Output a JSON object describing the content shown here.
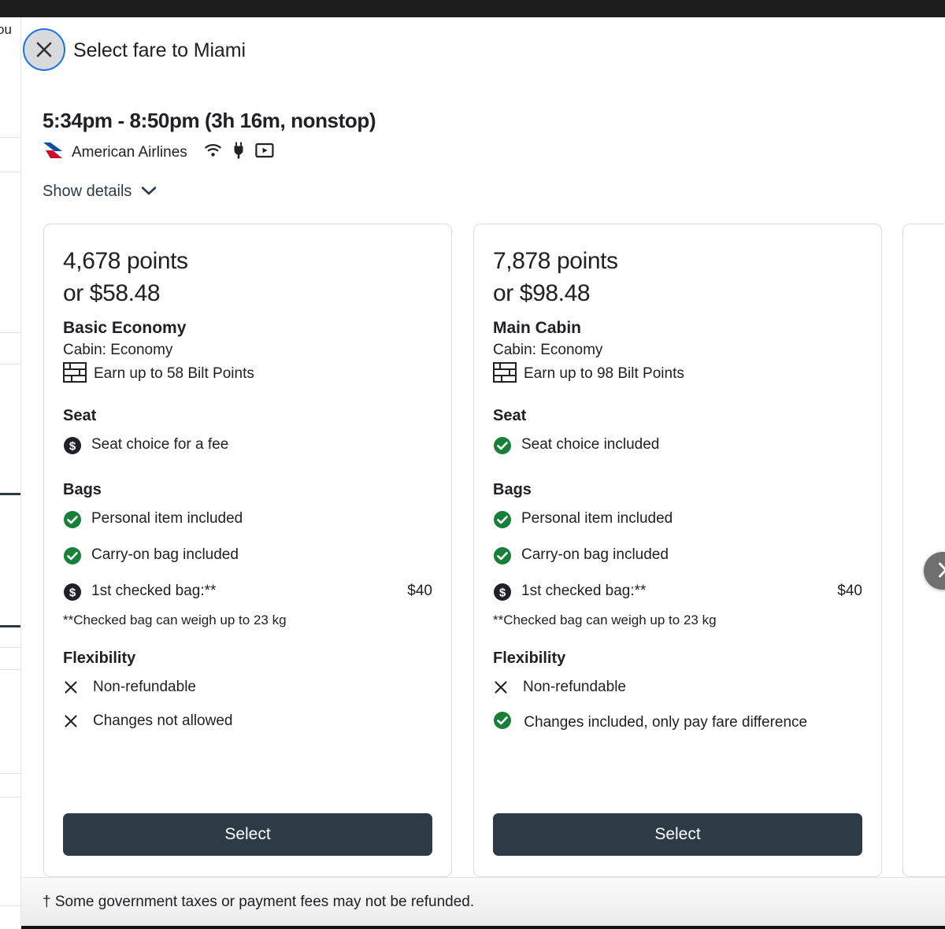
{
  "header": {
    "close_icon": "close-icon",
    "title": "Select fare to Miami"
  },
  "background_page": {
    "text_fragment": "ou"
  },
  "flight": {
    "times": "5:34pm - 8:50pm (3h 16m, nonstop)",
    "airline": "American Airlines",
    "airline_logo": "american-airlines-logo",
    "amenities": [
      "wifi-icon",
      "power-outlet-icon",
      "in-flight-entertainment-icon"
    ],
    "show_details_label": "Show details",
    "show_details_chevron": "chevron-down-icon"
  },
  "fares": [
    {
      "points": "4,678 points",
      "cash": "or $58.48",
      "name": "Basic Economy",
      "cabin": "Cabin: Economy",
      "earn_icon": "bilt-brick-icon",
      "earn": "Earn up to 58 Bilt Points",
      "seat_title": "Seat",
      "seat": [
        {
          "icon": "fee-dollar-icon",
          "label": "Seat choice for a fee"
        }
      ],
      "bags_title": "Bags",
      "bags": [
        {
          "icon": "check-circle-icon",
          "label": "Personal item included",
          "amount": ""
        },
        {
          "icon": "check-circle-icon",
          "label": "Carry-on bag included",
          "amount": ""
        },
        {
          "icon": "fee-dollar-icon",
          "label": "1st checked bag:**",
          "amount": "$40"
        }
      ],
      "bags_note": "**Checked bag can weigh up to 23 kg",
      "flex_title": "Flexibility",
      "flexibility": [
        {
          "icon": "x-icon",
          "label": "Non-refundable"
        },
        {
          "icon": "x-icon",
          "label": "Changes not allowed"
        }
      ],
      "select_label": "Select"
    },
    {
      "points": "7,878 points",
      "cash": "or $98.48",
      "name": "Main Cabin",
      "cabin": "Cabin: Economy",
      "earn_icon": "bilt-brick-icon",
      "earn": "Earn up to 98 Bilt Points",
      "seat_title": "Seat",
      "seat": [
        {
          "icon": "check-circle-icon",
          "label": "Seat choice included"
        }
      ],
      "bags_title": "Bags",
      "bags": [
        {
          "icon": "check-circle-icon",
          "label": "Personal item included",
          "amount": ""
        },
        {
          "icon": "check-circle-icon",
          "label": "Carry-on bag included",
          "amount": ""
        },
        {
          "icon": "fee-dollar-icon",
          "label": "1st checked bag:**",
          "amount": "$40"
        }
      ],
      "bags_note": "**Checked bag can weigh up to 23 kg",
      "flex_title": "Flexibility",
      "flexibility": [
        {
          "icon": "x-icon",
          "label": "Non-refundable"
        },
        {
          "icon": "check-circle-icon",
          "label": "Changes included, only pay fare difference"
        }
      ],
      "select_label": "Select"
    }
  ],
  "carousel": {
    "next_icon": "chevron-right-icon"
  },
  "footer": {
    "disclaimer": "† Some government taxes or payment fees may not be refunded."
  },
  "colors": {
    "check_green": "#178038",
    "fee_dark": "#202124",
    "button_slate": "#2d3b47",
    "focus_blue": "#1a73e8",
    "card_border": "#dadce0",
    "aa_blue": "#0b4ea2",
    "aa_red": "#c8102e"
  }
}
